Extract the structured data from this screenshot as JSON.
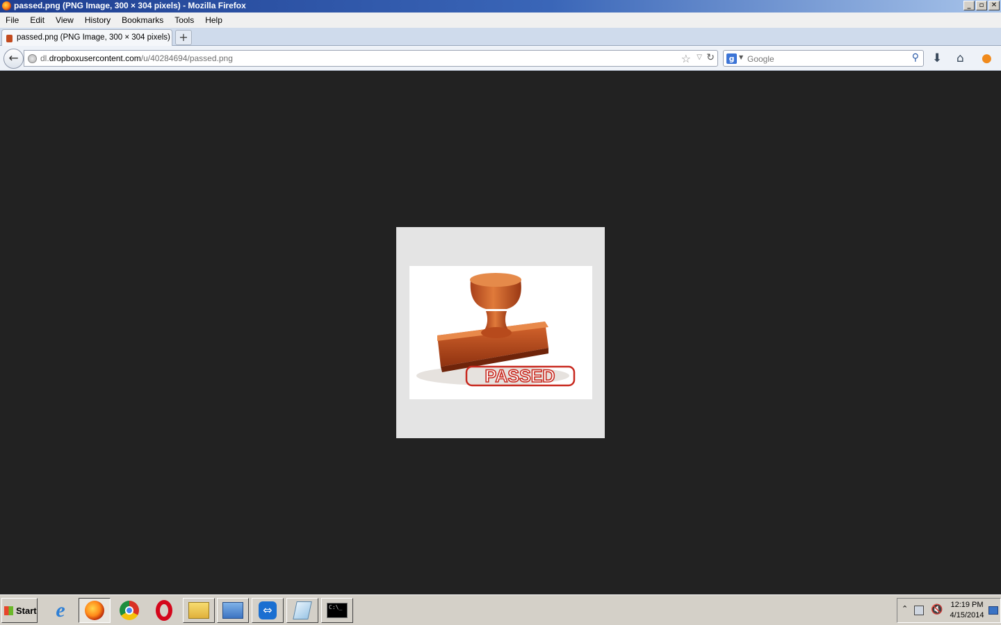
{
  "window": {
    "title": "passed.png (PNG Image, 300 × 304 pixels) - Mozilla Firefox",
    "controls": {
      "minimize": "_",
      "restore": "▫",
      "close": "✕"
    }
  },
  "menu": [
    "File",
    "Edit",
    "View",
    "History",
    "Bookmarks",
    "Tools",
    "Help"
  ],
  "tab": {
    "label": "passed.png (PNG Image, 300 × 304 pixels)",
    "new_tab": "+"
  },
  "nav": {
    "url_host_prefix": "dl.",
    "url_domain": "dropboxusercontent.com",
    "url_path": "/u/40284694/passed.png",
    "search_placeholder": "Google"
  },
  "image": {
    "stamp_text": "PASSED",
    "accent": "#c8281e"
  },
  "taskbar": {
    "start_label": "Start",
    "apps": [
      "ie-icon",
      "firefox-icon",
      "chrome-icon",
      "opera-icon",
      "file-explorer-icon",
      "control-panel-icon",
      "teamviewer-icon",
      "notepad-icon",
      "cmd-icon"
    ],
    "time": "12:19 PM",
    "date": "4/15/2014"
  }
}
